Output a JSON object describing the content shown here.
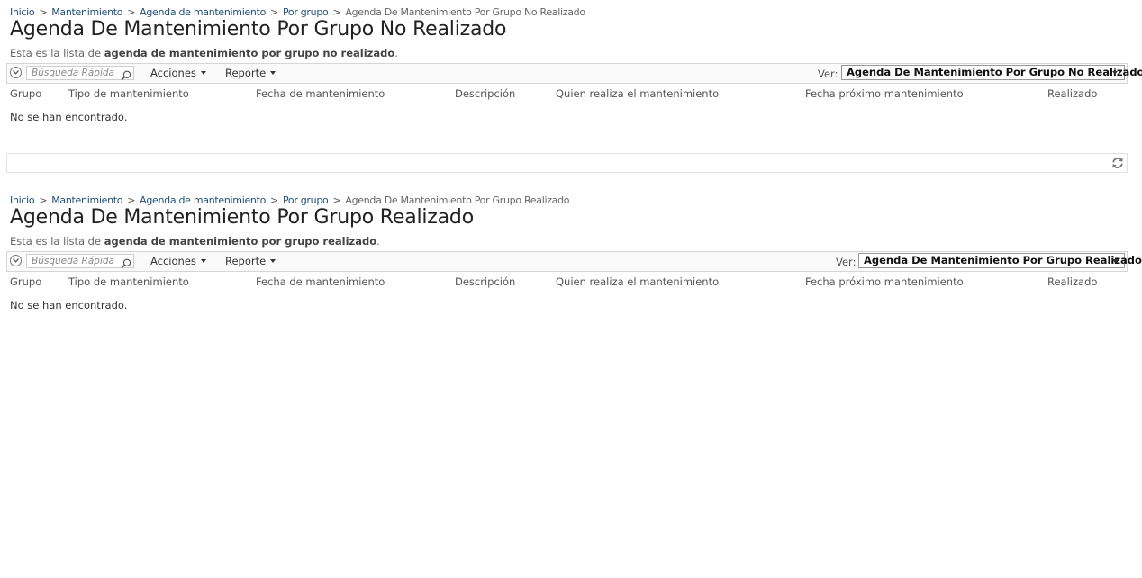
{
  "sections": [
    {
      "breadcrumb": {
        "items": [
          "Inicio",
          "Mantenimiento",
          "Agenda de mantenimiento",
          "Por grupo"
        ],
        "current": "Agenda De Mantenimiento Por Grupo No Realizado",
        "separator": ">"
      },
      "title": "Agenda De Mantenimiento Por Grupo No Realizado",
      "description": {
        "prefix": "Esta es la lista de ",
        "bold": "agenda de mantenimiento por grupo no realizado",
        "suffix": "."
      },
      "toolbar": {
        "search_placeholder": "Búsqueda Rápida",
        "acciones": "Acciones",
        "reporte": "Reporte",
        "ver_label": "Ver:",
        "view_selected": "Agenda De Mantenimiento Por Grupo No Realizado"
      },
      "columns": [
        "Grupo",
        "Tipo de mantenimiento",
        "Fecha de mantenimiento",
        "Descripción",
        "Quien realiza el mantenimiento",
        "Fecha próximo mantenimiento",
        "Realizado"
      ],
      "empty_message": "No se han encontrado."
    },
    {
      "breadcrumb": {
        "items": [
          "Inicio",
          "Mantenimiento",
          "Agenda de mantenimiento",
          "Por grupo"
        ],
        "current": "Agenda De Mantenimiento Por Grupo Realizado",
        "separator": ">"
      },
      "title": "Agenda De Mantenimiento Por Grupo Realizado",
      "description": {
        "prefix": "Esta es la lista de ",
        "bold": "agenda de mantenimiento por grupo realizado",
        "suffix": "."
      },
      "toolbar": {
        "search_placeholder": "Búsqueda Rápida",
        "acciones": "Acciones",
        "reporte": "Reporte",
        "ver_label": "Ver:",
        "view_selected": "Agenda De Mantenimiento Por Grupo Realizado"
      },
      "columns": [
        "Grupo",
        "Tipo de mantenimiento",
        "Fecha de mantenimiento",
        "Descripción",
        "Quien realiza el mantenimiento",
        "Fecha próximo mantenimiento",
        "Realizado"
      ],
      "empty_message": "No se han encontrado."
    }
  ],
  "icons": {
    "expand": "chevron-down-circle-icon",
    "search": "search-icon",
    "refresh": "refresh-icon"
  },
  "colors": {
    "link": "#1f4e79",
    "border": "#d6d6d6",
    "toolbar_bg": "#fafafa"
  }
}
